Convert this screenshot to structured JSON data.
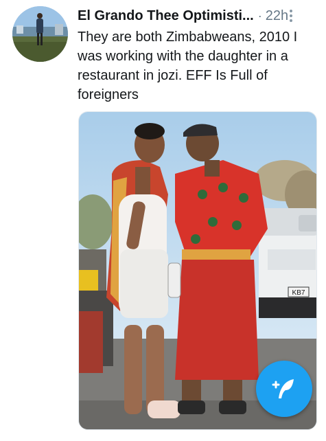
{
  "tweet": {
    "display_name": "El Grando Thee Optimisti...",
    "separator": "·",
    "time": "22h",
    "text": "They are both Zimbabweans, 2010 I was working with the daughter in a restaurant in jozi. EFF Is Full of foreigners",
    "media": {
      "plate_text": "KB7"
    }
  },
  "icons": {
    "more": "more-vertical-icon",
    "compose": "compose-tweet-icon"
  },
  "colors": {
    "accent": "#1da1f2",
    "text": "#14171a",
    "muted": "#657786"
  }
}
